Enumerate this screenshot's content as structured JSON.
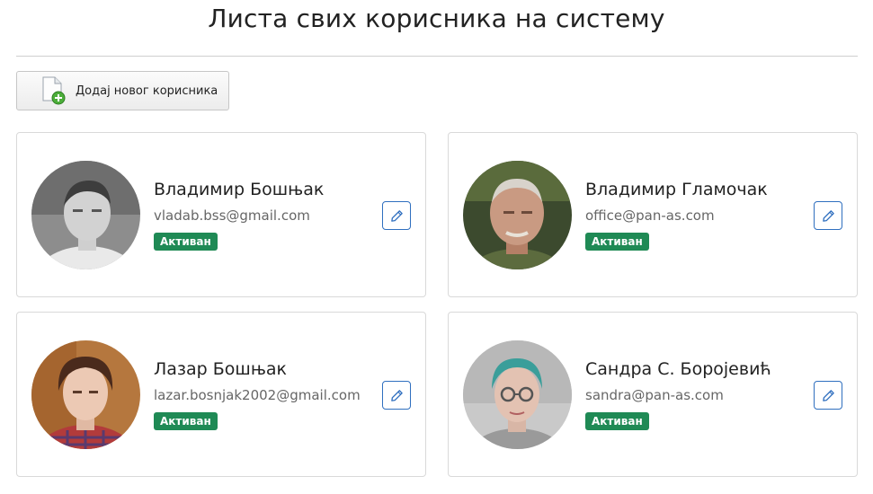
{
  "page": {
    "title": "Листа свих корисника на систему"
  },
  "toolbar": {
    "add_user_label": "Додај новог корисника",
    "add_user_icon": "file-add-icon"
  },
  "users": [
    {
      "name": "Владимир Бошњак",
      "email": "vladab.bss@gmail.com",
      "status": "Активан"
    },
    {
      "name": "Владимир Гламочак",
      "email": "office@pan-as.com",
      "status": "Активан"
    },
    {
      "name": "Лазар Бошњак",
      "email": "lazar.bosnjak2002@gmail.com",
      "status": "Активан"
    },
    {
      "name": "Сандра С. Боројевић",
      "email": "sandra@pan-as.com",
      "status": "Активан"
    }
  ],
  "colors": {
    "status_badge": "#1f8a55",
    "edit_button": "#2f6fbf"
  }
}
